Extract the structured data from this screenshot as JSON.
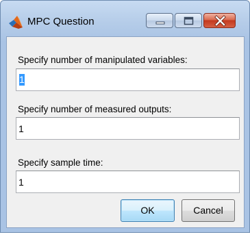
{
  "window": {
    "title": "MPC Question",
    "icon": "matlab-logo-icon"
  },
  "form": {
    "fields": [
      {
        "label": "Specify number of manipulated variables:",
        "value": "1",
        "selected": true
      },
      {
        "label": "Specify number of measured outputs:",
        "value": "1",
        "selected": false
      },
      {
        "label": "Specify sample time:",
        "value": "1",
        "selected": false
      }
    ]
  },
  "buttons": {
    "ok_label": "OK",
    "cancel_label": "Cancel"
  },
  "colors": {
    "selection": "#3399ff",
    "close_button": "#c3391e",
    "title_bar": "#b6cde9"
  }
}
